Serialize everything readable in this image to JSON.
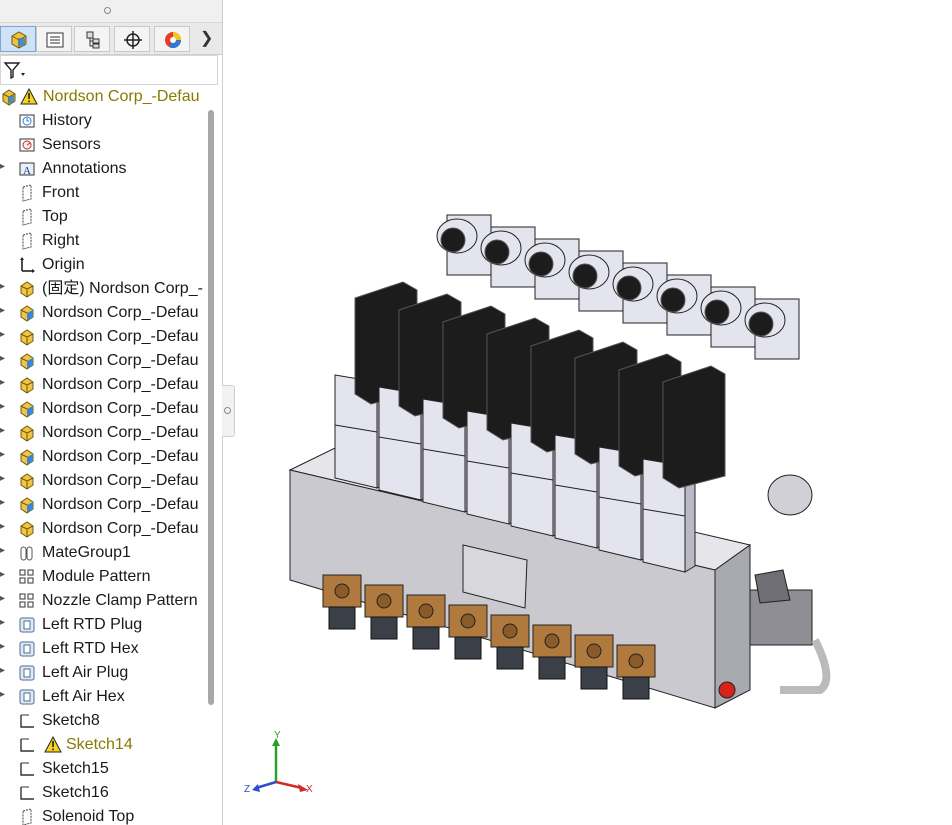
{
  "tabs": [
    {
      "name": "feature-manager-tab",
      "icon": "assembly-icon",
      "active": true
    },
    {
      "name": "property-manager-tab",
      "icon": "property-list-icon",
      "active": false
    },
    {
      "name": "configuration-manager-tab",
      "icon": "configuration-icon",
      "active": false
    },
    {
      "name": "dimxpert-tab",
      "icon": "crosshair-icon",
      "active": false
    },
    {
      "name": "display-manager-tab",
      "icon": "appearance-pie-icon",
      "active": false
    }
  ],
  "tree": {
    "root": {
      "label": "Nordson Corp_-Defau",
      "icon": "assembly-icon",
      "warning": true
    },
    "items": [
      {
        "label": "History",
        "icon": "history-icon",
        "expand": false
      },
      {
        "label": "Sensors",
        "icon": "sensor-icon",
        "expand": false
      },
      {
        "label": "Annotations",
        "icon": "annotations-icon",
        "expand": true
      },
      {
        "label": "Front",
        "icon": "plane-icon",
        "expand": false
      },
      {
        "label": "Top",
        "icon": "plane-icon",
        "expand": false
      },
      {
        "label": "Right",
        "icon": "plane-icon",
        "expand": false
      },
      {
        "label": "Origin",
        "icon": "origin-icon",
        "expand": false
      },
      {
        "label": "(固定) Nordson Corp_-",
        "icon": "part-yellow-icon",
        "expand": true
      },
      {
        "label": "Nordson Corp_-Defau",
        "icon": "part-blue-icon",
        "expand": true
      },
      {
        "label": "Nordson Corp_-Defau",
        "icon": "part-yellow-icon",
        "expand": true
      },
      {
        "label": "Nordson Corp_-Defau",
        "icon": "part-blue-icon",
        "expand": true
      },
      {
        "label": "Nordson Corp_-Defau",
        "icon": "part-yellow-icon",
        "expand": true
      },
      {
        "label": "Nordson Corp_-Defau",
        "icon": "part-blue-icon",
        "expand": true
      },
      {
        "label": "Nordson Corp_-Defau",
        "icon": "part-yellow-icon",
        "expand": true
      },
      {
        "label": "Nordson Corp_-Defau",
        "icon": "part-blue-icon",
        "expand": true
      },
      {
        "label": "Nordson Corp_-Defau",
        "icon": "part-yellow-icon",
        "expand": true
      },
      {
        "label": "Nordson Corp_-Defau",
        "icon": "part-blue-icon",
        "expand": true
      },
      {
        "label": "Nordson Corp_-Defau",
        "icon": "part-yellow-icon",
        "expand": true
      },
      {
        "label": "MateGroup1",
        "icon": "mate-icon",
        "expand": true
      },
      {
        "label": "Module Pattern",
        "icon": "pattern-icon",
        "expand": true
      },
      {
        "label": "Nozzle Clamp Pattern",
        "icon": "pattern-icon",
        "expand": true
      },
      {
        "label": "Left RTD Plug",
        "icon": "feature-icon",
        "expand": true
      },
      {
        "label": "Left RTD Hex",
        "icon": "feature-icon",
        "expand": true
      },
      {
        "label": "Left Air Plug",
        "icon": "feature-icon",
        "expand": true
      },
      {
        "label": "Left Air Hex",
        "icon": "feature-icon",
        "expand": true
      },
      {
        "label": "Sketch8",
        "icon": "sketch-icon",
        "expand": false
      },
      {
        "label": "Sketch14",
        "icon": "sketch-icon",
        "expand": false,
        "warning": true
      },
      {
        "label": "Sketch15",
        "icon": "sketch-icon",
        "expand": false
      },
      {
        "label": "Sketch16",
        "icon": "sketch-icon",
        "expand": false
      },
      {
        "label": "Solenoid Top",
        "icon": "plane-icon",
        "expand": false
      }
    ]
  },
  "triad": {
    "x": "X",
    "y": "Y",
    "z": "Z"
  },
  "colors": {
    "warning": "#8a7a00",
    "accent": "#7aa6d6",
    "metal": "#c9c9cf",
    "valve": "#1c1c1c",
    "brass": "#b07a3e"
  },
  "model": {
    "module_count": 8
  }
}
